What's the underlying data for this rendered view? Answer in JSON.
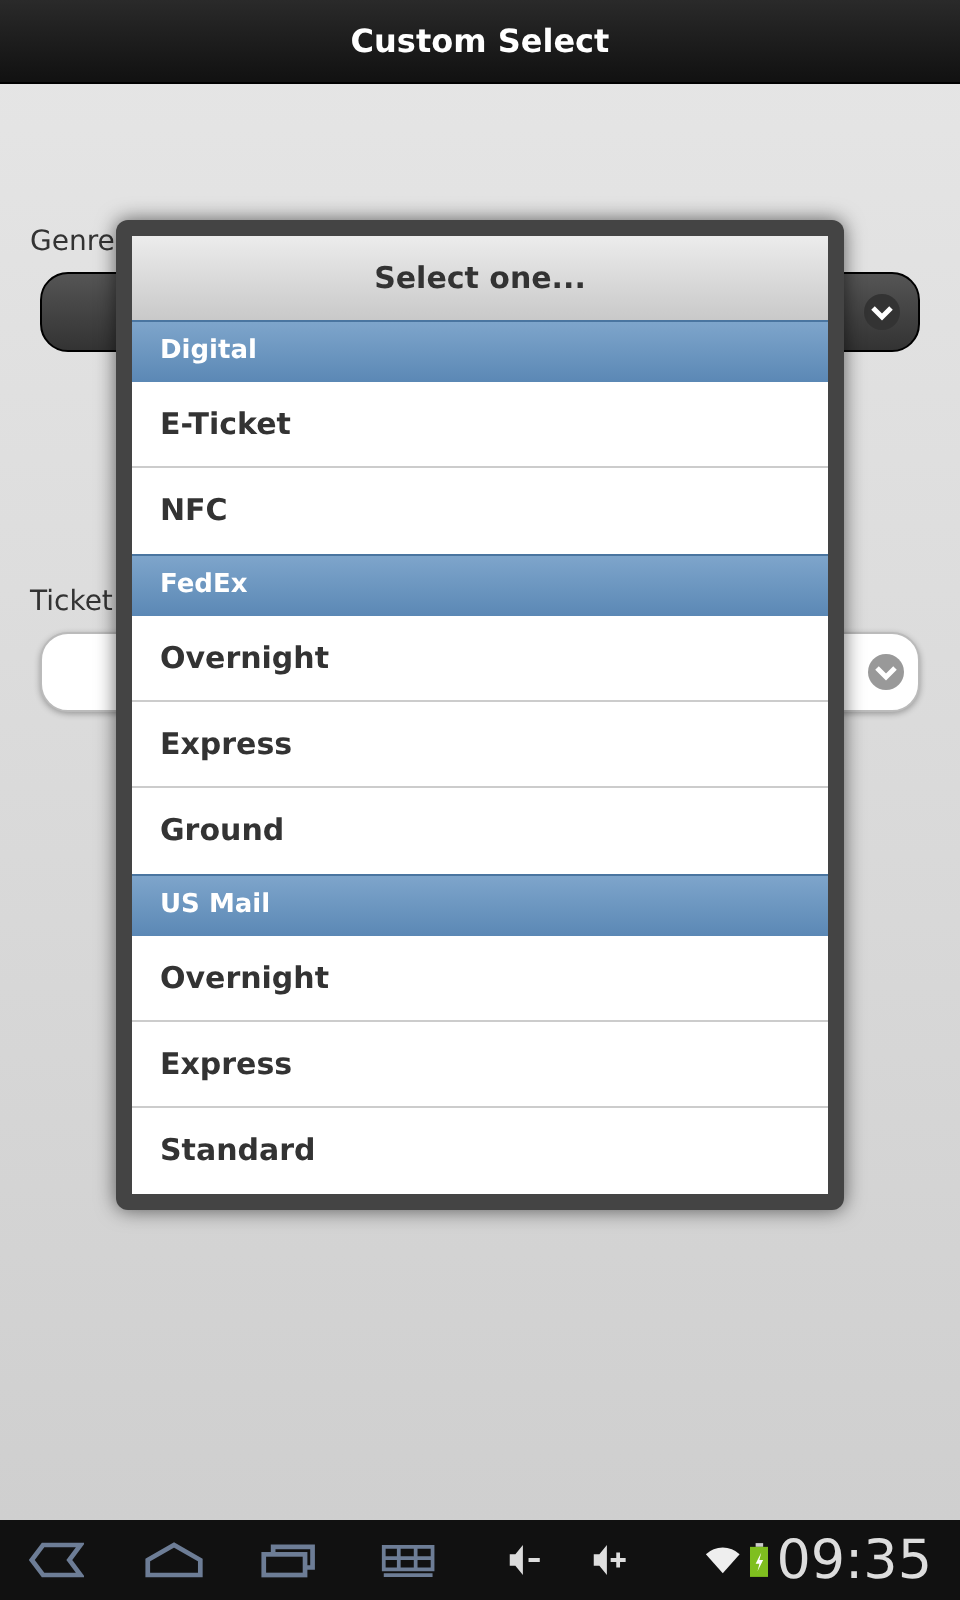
{
  "header": {
    "title": "Custom Select"
  },
  "form": {
    "fields": [
      {
        "label": "Genre",
        "kind": "dark"
      },
      {
        "label": "Ticket",
        "kind": "light"
      }
    ]
  },
  "popup": {
    "title": "Select one...",
    "groups": [
      {
        "label": "Digital",
        "options": [
          {
            "label": "E-Ticket"
          },
          {
            "label": "NFC"
          }
        ]
      },
      {
        "label": "FedEx",
        "options": [
          {
            "label": "Overnight"
          },
          {
            "label": "Express"
          },
          {
            "label": "Ground"
          }
        ]
      },
      {
        "label": "US Mail",
        "options": [
          {
            "label": "Overnight"
          },
          {
            "label": "Express"
          },
          {
            "label": "Standard"
          }
        ]
      }
    ]
  },
  "system_bar": {
    "time": "09:35"
  }
}
